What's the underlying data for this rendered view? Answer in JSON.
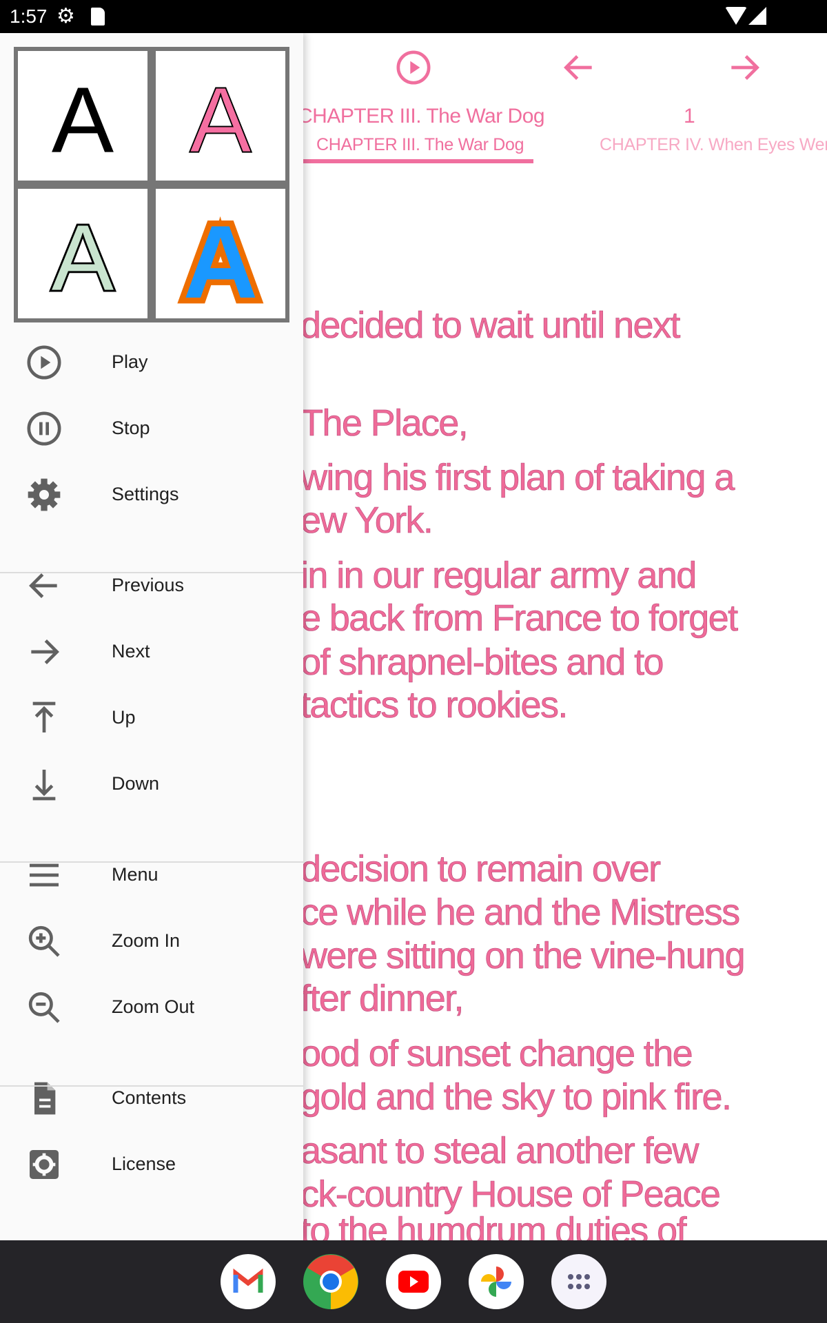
{
  "status_bar": {
    "time": "1:57",
    "icons": [
      "gear-icon",
      "sd-card-icon",
      "wifi-icon",
      "cell-signal-icon"
    ]
  },
  "colors": {
    "accent": "#f06f9e",
    "text_pink": "#ef6a98",
    "drawer_bg": "#fafafa",
    "nav_bg": "#252428"
  },
  "toolbar": {
    "icons": [
      "play-circle-icon",
      "arrow-back-icon",
      "arrow-forward-icon"
    ],
    "current_title": "CHAPTER III. The War Dog",
    "page_number": "1",
    "tabs": [
      {
        "label": "CHAPTER III. The War Dog",
        "selected": true
      },
      {
        "label": "CHAPTER IV. When Eyes Were",
        "selected": false
      }
    ]
  },
  "theme_picker": {
    "tiles": [
      {
        "letter": "A",
        "style": "black"
      },
      {
        "letter": "A",
        "style": "pink"
      },
      {
        "letter": "A",
        "style": "green-outline"
      },
      {
        "letter": "A",
        "style": "orange-blue"
      }
    ]
  },
  "drawer": {
    "items": [
      {
        "label": "Play",
        "icon": "play-circle-icon"
      },
      {
        "label": "Stop",
        "icon": "pause-circle-icon"
      },
      {
        "label": "Settings",
        "icon": "gear-icon"
      },
      {
        "label": "Previous",
        "icon": "arrow-back-icon"
      },
      {
        "label": "Next",
        "icon": "arrow-forward-icon"
      },
      {
        "label": "Up",
        "icon": "arrow-up-bar-icon"
      },
      {
        "label": "Down",
        "icon": "arrow-down-bar-icon"
      },
      {
        "label": "Menu",
        "icon": "menu-icon"
      },
      {
        "label": "Zoom In",
        "icon": "zoom-in-icon"
      },
      {
        "label": "Zoom Out",
        "icon": "zoom-out-icon"
      },
      {
        "label": "Contents",
        "icon": "document-icon"
      },
      {
        "label": "License",
        "icon": "settings-box-icon"
      }
    ]
  },
  "content": {
    "lines": [
      "decided to wait until next",
      "The Place,",
      "wing his first plan of taking a",
      "ew York.",
      "in in our regular army and",
      "e back from France to forget",
      "of shrapnel-bites and to",
      "tactics to rookies.",
      " decision to remain over",
      "ce while he and the Mistress",
      "were sitting on the vine-hung",
      "fter dinner,",
      "ood of sunset change the",
      "gold and the sky to pink fire.",
      "asant to steal another few",
      "ck-country House of Peace",
      "to the humdrum duties of"
    ]
  },
  "dock": {
    "apps": [
      "Gmail",
      "Chrome",
      "YouTube",
      "Photos",
      "App drawer"
    ]
  }
}
